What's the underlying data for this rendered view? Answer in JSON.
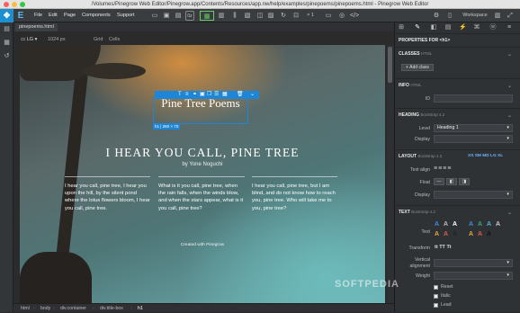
{
  "window": {
    "title": "/Volumes/Pinegrow Web Editor/Pinegrow.app/Contents/Resources/app.nw/help/examples/pinepoems/pinepoems.html - Pinegrow Web Editor"
  },
  "menu": {
    "file": "File",
    "edit": "Edit",
    "page": "Page",
    "components": "Components",
    "support": "Support"
  },
  "toolbar": {
    "zoom": "× 1",
    "workspace": "Workspace"
  },
  "tab": {
    "label": "pinepoems.html"
  },
  "device": {
    "size": "LG",
    "width": "1024 px",
    "grid": "Grid",
    "cells": "Cells"
  },
  "page": {
    "h1": "Pine Tree Poems",
    "selection_size": "h1 | 260 × 70",
    "h2": "I HEAR YOU CALL, PINE TREE",
    "byline": "by Yone Noguchi",
    "col1": "I hear you call, pine tree, I hear you upon the hill, by the silent pond where the lotus flowers bloom, I hear you call, pine tree.",
    "col2": "What is it you call, pine tree, when the rain falls, when the winds blow, and when the stars appear, what is it you call, pine tree?",
    "col3": "I hear you call, pine tree, but I am blind, and do not know how to reach you, pine tree. Who will take me to you, pine tree?",
    "credit": "Created with Pinegrow"
  },
  "breadcrumb": [
    "html",
    "body",
    "div.container",
    "div.title-box",
    "h1"
  ],
  "panel": {
    "header": "PROPERTIES FOR <h1>",
    "classes": "CLASSES",
    "classes_sub": "HTML",
    "add_class": "+ Add class",
    "info": "INFO",
    "info_sub": "HTML",
    "id_label": "ID",
    "heading": "HEADING",
    "heading_sub": "Bootstrap 4.2",
    "level_label": "Level",
    "level_value": "Heading 1",
    "display_label": "Display",
    "layout": "LAYOUT",
    "layout_sub": "Bootstrap 4.2",
    "breakpoints": "XS  SM  MD  LG  XL",
    "text_align": "Text align",
    "float": "Float",
    "display2": "Display",
    "text": "TEXT",
    "text_sub": "Bootstrap 4.2",
    "text_label": "Text",
    "transform": "Transform",
    "transform_opts": "tt  TT  Tt",
    "valign": "Vertical alignment",
    "weight": "Weight",
    "reset": "Reset",
    "italic": "Italic",
    "lead": "Lead"
  },
  "watermark": "SOFTPEDIA",
  "colors": {
    "accent": "#1d86d6",
    "panel": "#2f3235"
  }
}
